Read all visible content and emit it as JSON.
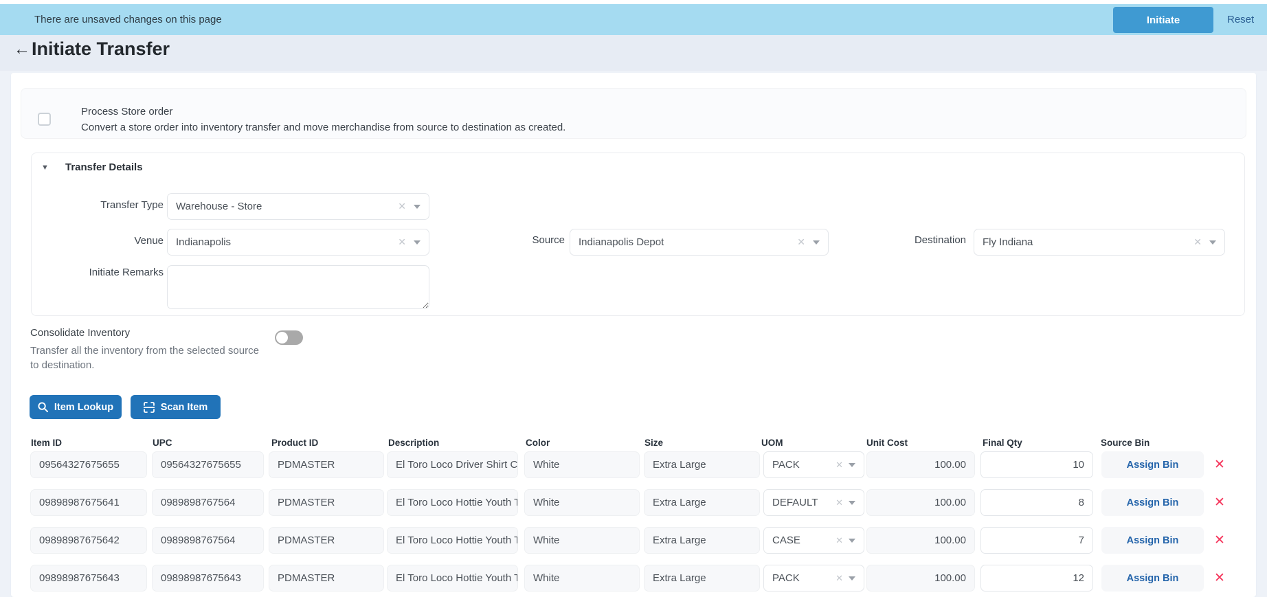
{
  "banner": {
    "message": "There are unsaved changes on this page",
    "initiate_label": "Initiate",
    "reset_label": "Reset"
  },
  "header": {
    "title": "Initiate Transfer"
  },
  "icons": {
    "back": "←",
    "caret": "▼",
    "clear": "✕",
    "delete": "✕"
  },
  "process_store_order": {
    "label": "Process Store order",
    "description": "Convert a store order into inventory transfer and move merchandise from source to destination as created.",
    "checked": false
  },
  "transfer_details": {
    "section_title": "Transfer Details",
    "fields": {
      "transfer_type": {
        "label": "Transfer Type",
        "value": "Warehouse - Store"
      },
      "venue": {
        "label": "Venue",
        "value": "Indianapolis"
      },
      "source": {
        "label": "Source",
        "value": "Indianapolis Depot"
      },
      "destination": {
        "label": "Destination",
        "value": "Fly Indiana"
      },
      "initiate_remarks": {
        "label": "Initiate Remarks",
        "value": ""
      }
    }
  },
  "consolidate_inventory": {
    "label": "Consolidate Inventory",
    "description": "Transfer all the inventory from the selected source to destination.",
    "enabled": false
  },
  "actions": {
    "item_lookup_label": "Item Lookup",
    "scan_item_label": "Scan Item"
  },
  "items_table": {
    "columns": [
      "Item ID",
      "UPC",
      "Product ID",
      "Description",
      "Color",
      "Size",
      "UOM",
      "Unit Cost",
      "Final Qty",
      "Source Bin"
    ],
    "assign_bin_label": "Assign Bin",
    "rows": [
      {
        "item_id": "09564327675655",
        "upc": "09564327675655",
        "product_id": "PDMASTER",
        "description": "El Toro Loco Driver Shirt Ca",
        "color": "White",
        "size": "Extra Large",
        "uom": "PACK",
        "unit_cost": "100.00",
        "final_qty": "10"
      },
      {
        "item_id": "09898987675641",
        "upc": "0989898767564",
        "product_id": "PDMASTER",
        "description": "El Toro Loco Hottie Youth Te",
        "color": "White",
        "size": "Extra Large",
        "uom": "DEFAULT",
        "unit_cost": "100.00",
        "final_qty": "8"
      },
      {
        "item_id": "09898987675642",
        "upc": "0989898767564",
        "product_id": "PDMASTER",
        "description": "El Toro Loco Hottie Youth Te",
        "color": "White",
        "size": "Extra Large",
        "uom": "CASE",
        "unit_cost": "100.00",
        "final_qty": "7"
      },
      {
        "item_id": "09898987675643",
        "upc": "09898987675643",
        "product_id": "PDMASTER",
        "description": "El Toro Loco Hottie Youth Ti",
        "color": "White",
        "size": "Extra Large",
        "uom": "PACK",
        "unit_cost": "100.00",
        "final_qty": "12"
      }
    ]
  },
  "colors": {
    "banner_bg": "#a5dbf1",
    "primary_button": "#3f9ad2",
    "action_button": "#2173b8",
    "reset_link": "#2b5f93",
    "assign_bin_link": "#2565ab",
    "delete_icon": "#f5365c"
  }
}
